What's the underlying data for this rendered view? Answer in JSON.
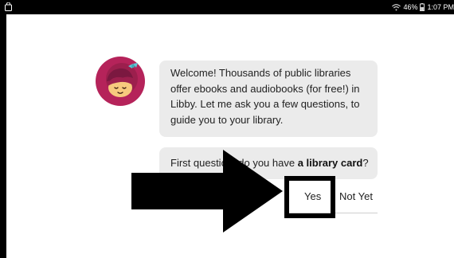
{
  "status_bar": {
    "battery": "46%",
    "time": "1:07 PM",
    "icons": [
      "bag-icon",
      "wifi-icon",
      "battery-icon"
    ]
  },
  "chat": {
    "avatar_icon": "libby-avatar",
    "welcome_message": "Welcome! Thousands of public libraries offer ebooks and audiobooks (for free!) in Libby. Let me ask you a few questions, to guide you to your library.",
    "question_prefix": "First question: do you have ",
    "question_bold": "a library card",
    "question_suffix": "?"
  },
  "choices": {
    "yes_label": "Yes",
    "not_yet_label": "Not Yet"
  },
  "annotation": {
    "arrow_icon": "right-arrow-icon",
    "highlight_target": "Yes",
    "colors": {
      "arrow": "#000000",
      "highlight": "#000000"
    }
  },
  "colors": {
    "bubble_bg": "#ebebeb",
    "avatar_bg": "#b5235a",
    "status_bg": "#000000"
  }
}
